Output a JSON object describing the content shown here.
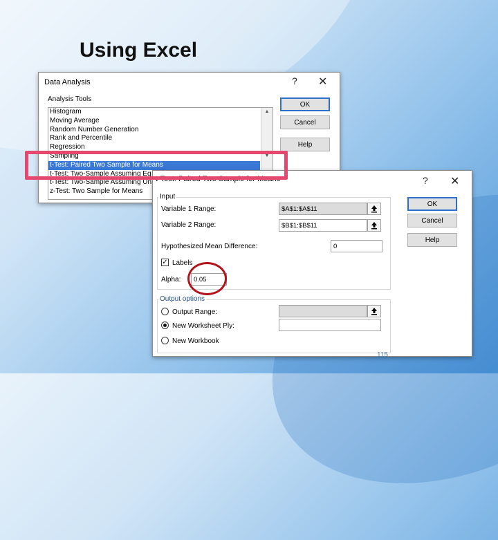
{
  "slide": {
    "title": "Using Excel",
    "page_number": "115"
  },
  "data_analysis": {
    "title": "Data Analysis",
    "help_glyph": "?",
    "close_glyph": "✕",
    "tools_label": "Analysis Tools",
    "items": [
      "Histogram",
      "Moving Average",
      "Random Number Generation",
      "Rank and Percentile",
      "Regression",
      "Sampling",
      "t-Test: Paired Two Sample for Means",
      "t-Test: Two-Sample Assuming Eq",
      "t-Test: Two-Sample Assuming Un",
      "z-Test: Two Sample for Means"
    ],
    "selected_index": 6,
    "ok_label": "OK",
    "cancel_label": "Cancel",
    "help_label": "Help"
  },
  "ttest": {
    "title": "t-Test: Paired Two Sample for Means",
    "help_glyph": "?",
    "close_glyph": "✕",
    "input_label": "Input",
    "var1_label": "Variable 1 Range:",
    "var1_value": "$A$1:$A$11",
    "var2_label": "Variable 2 Range:",
    "var2_value": "$B$1:$B$11",
    "hyp_label": "Hypothesized Mean Difference:",
    "hyp_value": "0",
    "labels_label": "Labels",
    "labels_checked": true,
    "check_glyph": "✓",
    "alpha_label": "Alpha:",
    "alpha_value": "0.05",
    "output_label": "Output options",
    "output_range_label": "Output Range:",
    "output_range_value": "",
    "new_ply_label": "New Worksheet Ply:",
    "new_ply_value": "",
    "new_workbook_label": "New Workbook",
    "selected_output": "new_ply",
    "ok_label": "OK",
    "cancel_label": "Cancel",
    "help_label": "Help"
  },
  "colors": {
    "accent": "#3a78d6",
    "highlight_box": "#e5486e",
    "circle": "#b3141c"
  }
}
